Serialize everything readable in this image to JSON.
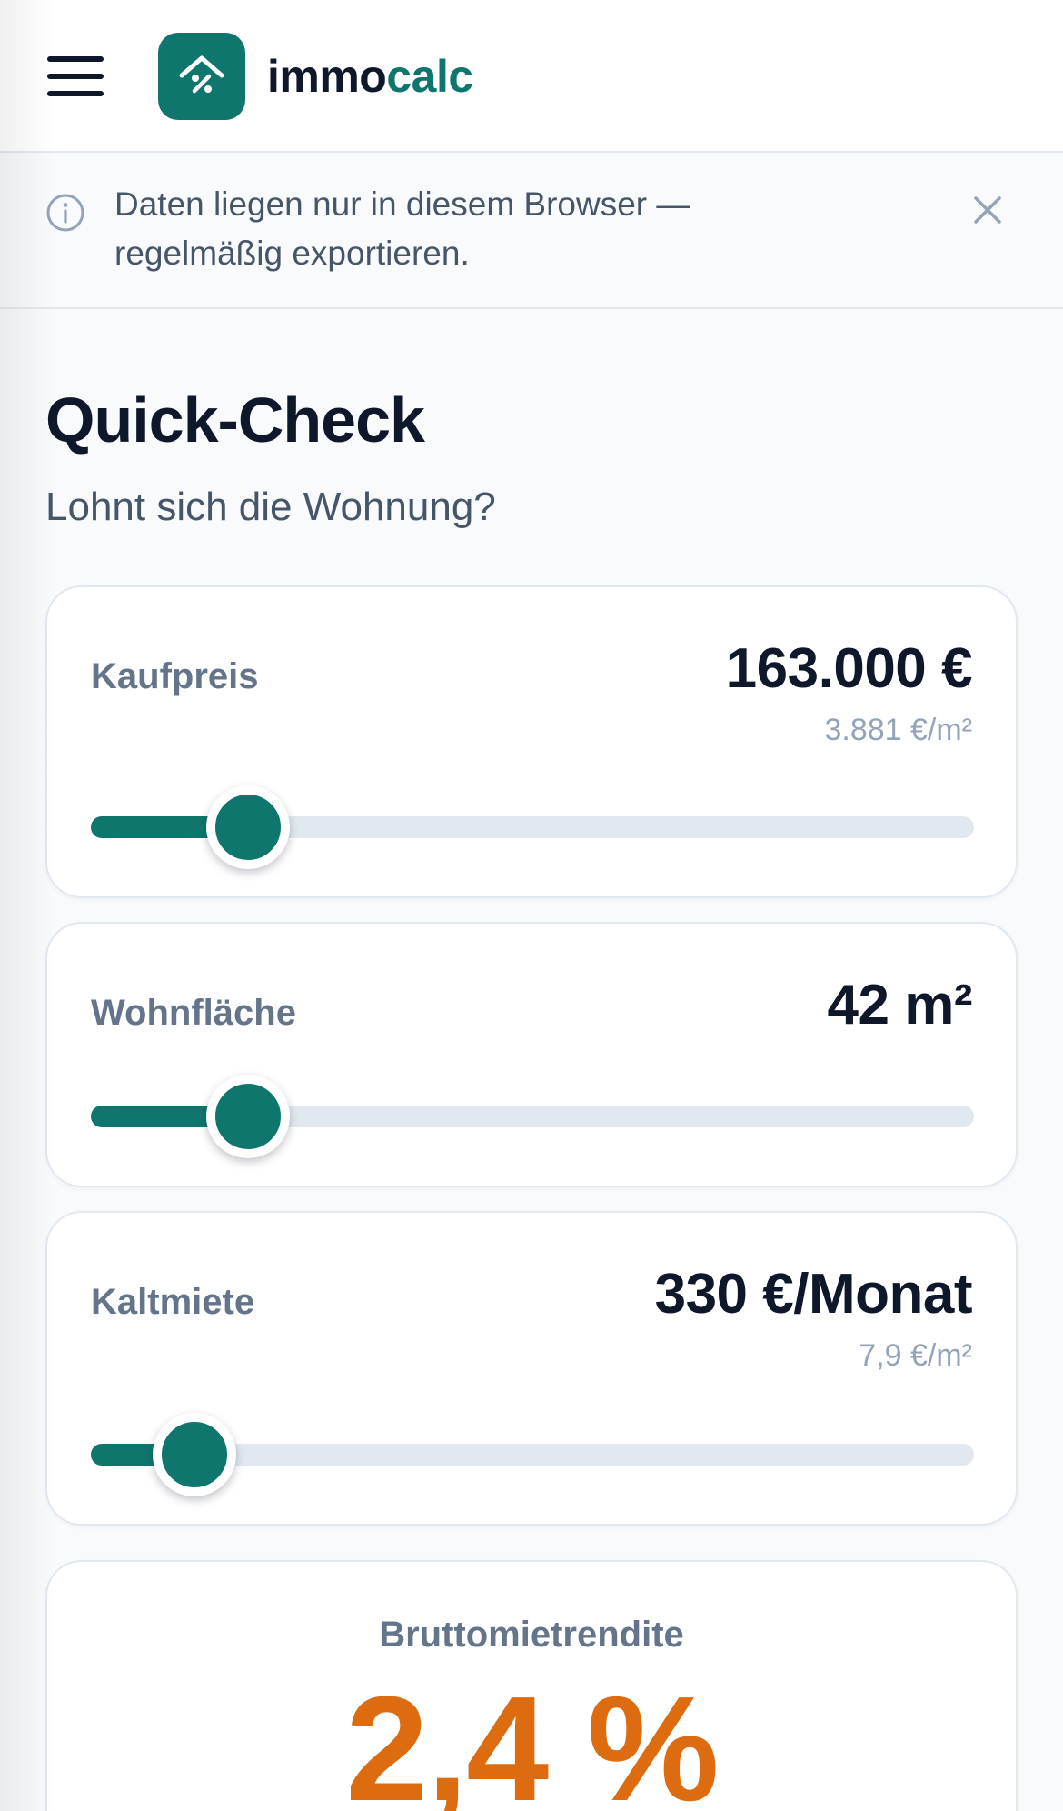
{
  "header": {
    "brand_part1": "immo",
    "brand_part2": "calc"
  },
  "notice": {
    "text": "Daten liegen nur in diesem Browser — regelmäßig exportieren."
  },
  "page": {
    "title": "Quick-Check",
    "subtitle": "Lohnt sich die Wohnung?"
  },
  "inputs": {
    "kaufpreis": {
      "label": "Kaufpreis",
      "value": "163.000 €",
      "sub": "3.881 €/m²",
      "slider_fraction": 0.178
    },
    "wohnflaeche": {
      "label": "Wohnfläche",
      "value": "42 m²"
    },
    "kaltmiete": {
      "label": "Kaltmiete",
      "value": "330 €/Monat",
      "sub": "7,9 €/m²",
      "slider_fraction": 0.117
    }
  },
  "slider_wohnflaeche_fraction": 0.178,
  "result": {
    "label": "Bruttomietrendite",
    "value": "2,4 %"
  },
  "colors": {
    "accent": "#0f766e",
    "result": "#dd6b0f",
    "track": "#e2e8f0"
  }
}
